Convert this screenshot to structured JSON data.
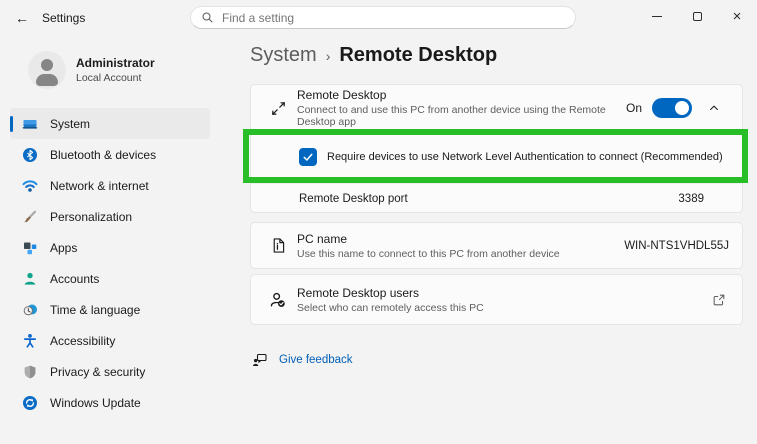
{
  "titlebar": {
    "back": "←",
    "title": "Settings",
    "search_placeholder": "Find a setting",
    "close_glyph": "×"
  },
  "user": {
    "name": "Administrator",
    "type": "Local Account"
  },
  "sidebar": {
    "items": [
      {
        "label": "System",
        "icon": "system-icon",
        "selected": true
      },
      {
        "label": "Bluetooth & devices",
        "icon": "bluetooth-icon",
        "selected": false
      },
      {
        "label": "Network & internet",
        "icon": "network-icon",
        "selected": false
      },
      {
        "label": "Personalization",
        "icon": "personalization-icon",
        "selected": false
      },
      {
        "label": "Apps",
        "icon": "apps-icon",
        "selected": false
      },
      {
        "label": "Accounts",
        "icon": "accounts-icon",
        "selected": false
      },
      {
        "label": "Time & language",
        "icon": "time-language-icon",
        "selected": false
      },
      {
        "label": "Accessibility",
        "icon": "accessibility-icon",
        "selected": false
      },
      {
        "label": "Privacy & security",
        "icon": "privacy-icon",
        "selected": false
      },
      {
        "label": "Windows Update",
        "icon": "windows-update-icon",
        "selected": false
      }
    ]
  },
  "breadcrumb": {
    "parent": "System",
    "separator": "›",
    "current": "Remote Desktop"
  },
  "remote_desktop_card": {
    "title": "Remote Desktop",
    "description": "Connect to and use this PC from another device using the Remote Desktop app",
    "toggle_label": "On",
    "toggle_state": "on",
    "nla_checkbox_label": "Require devices to use Network Level Authentication to connect (Recommended)",
    "nla_checked": true,
    "port_label": "Remote Desktop port",
    "port_value": "3389"
  },
  "pc_name_card": {
    "title": "PC name",
    "description": "Use this name to connect to this PC from another device",
    "value": "WIN-NTS1VHDL55J"
  },
  "users_card": {
    "title": "Remote Desktop users",
    "description": "Select who can remotely access this PC"
  },
  "feedback": {
    "label": "Give feedback"
  },
  "highlight": {
    "color": "#27be27"
  },
  "colors": {
    "accent": "#0067c0",
    "link": "#005fb8",
    "window_bg": "#f3f3f3",
    "card_bg": "#fbfbfb",
    "card_border": "#e5e5e5",
    "selected_nav_bg": "#eaeaea",
    "text_primary": "#1b1b1b",
    "text_secondary": "#5e5e5e"
  }
}
